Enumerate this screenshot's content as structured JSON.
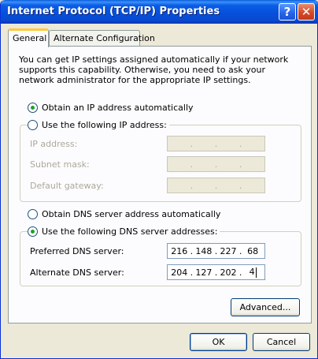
{
  "window": {
    "title": "Internet Protocol (TCP/IP) Properties",
    "help_label": "?",
    "close_label": "✕"
  },
  "tabs": [
    {
      "label": "General",
      "active": true
    },
    {
      "label": "Alternate Configuration",
      "active": false
    }
  ],
  "intro_text": "You can get IP settings assigned automatically if your network supports this capability. Otherwise, you need to ask your network administrator for the appropriate IP settings.",
  "ip_mode": {
    "auto_label": "Obtain an IP address automatically",
    "auto_checked": true,
    "manual_label": "Use the following IP address:",
    "manual_checked": false,
    "fields": [
      {
        "label": "IP address:",
        "value": ". . ."
      },
      {
        "label": "Subnet mask:",
        "value": ". . ."
      },
      {
        "label": "Default gateway:",
        "value": ". . ."
      }
    ]
  },
  "dns_mode": {
    "auto_label": "Obtain DNS server address automatically",
    "auto_checked": false,
    "manual_label": "Use the following DNS server addresses:",
    "manual_checked": true,
    "preferred": {
      "label": "Preferred DNS server:",
      "octets": [
        "216",
        "148",
        "227",
        "68"
      ]
    },
    "alternate": {
      "label": "Alternate DNS server:",
      "octets": [
        "204",
        "127",
        "202",
        "4"
      ]
    }
  },
  "buttons": {
    "advanced": "Advanced...",
    "ok": "OK",
    "cancel": "Cancel"
  },
  "colors": {
    "titlebar": "#0550dc",
    "dialog_bg": "#ece9d8",
    "panel_bg": "#fcfcfe",
    "radio_dot": "#21a121",
    "tab_highlight": "#ffc83c"
  }
}
